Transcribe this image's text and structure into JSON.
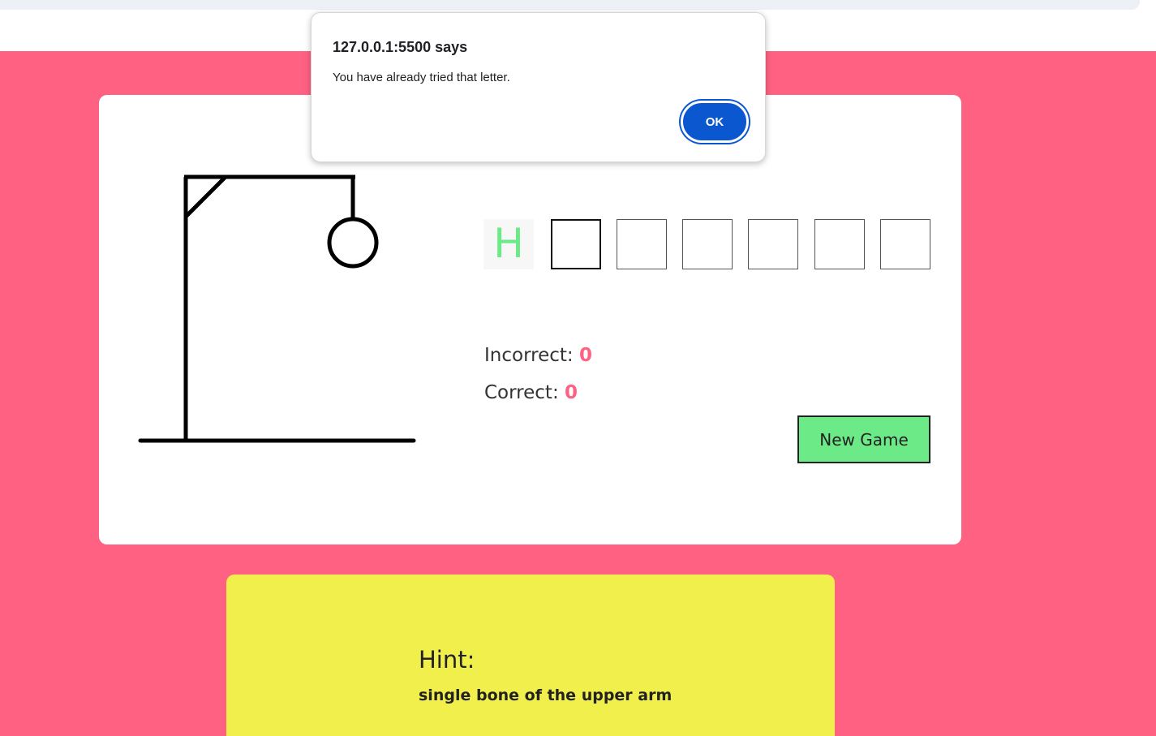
{
  "alert": {
    "origin": "127.0.0.1:5500 says",
    "message": "You have already tried that letter.",
    "ok_label": "OK"
  },
  "game": {
    "word_slots": [
      "H",
      "",
      "",
      "",
      "",
      "",
      ""
    ],
    "incorrect_label": "Incorrect:",
    "incorrect_count": "0",
    "correct_label": "Correct:",
    "correct_count": "0",
    "new_game_label": "New Game"
  },
  "hint": {
    "title": "Hint:",
    "text": "single bone of the upper arm"
  },
  "colors": {
    "page_background": "#ff6183",
    "revealed_letter": "#6cea88",
    "count_number": "#ff6183",
    "new_game_button": "#6cea88",
    "hint_background": "#f0ef4c",
    "alert_button": "#0b57d0"
  },
  "hangman": {
    "wrong_guesses_drawn": 1,
    "parts_visible": [
      "gallows",
      "head"
    ]
  }
}
